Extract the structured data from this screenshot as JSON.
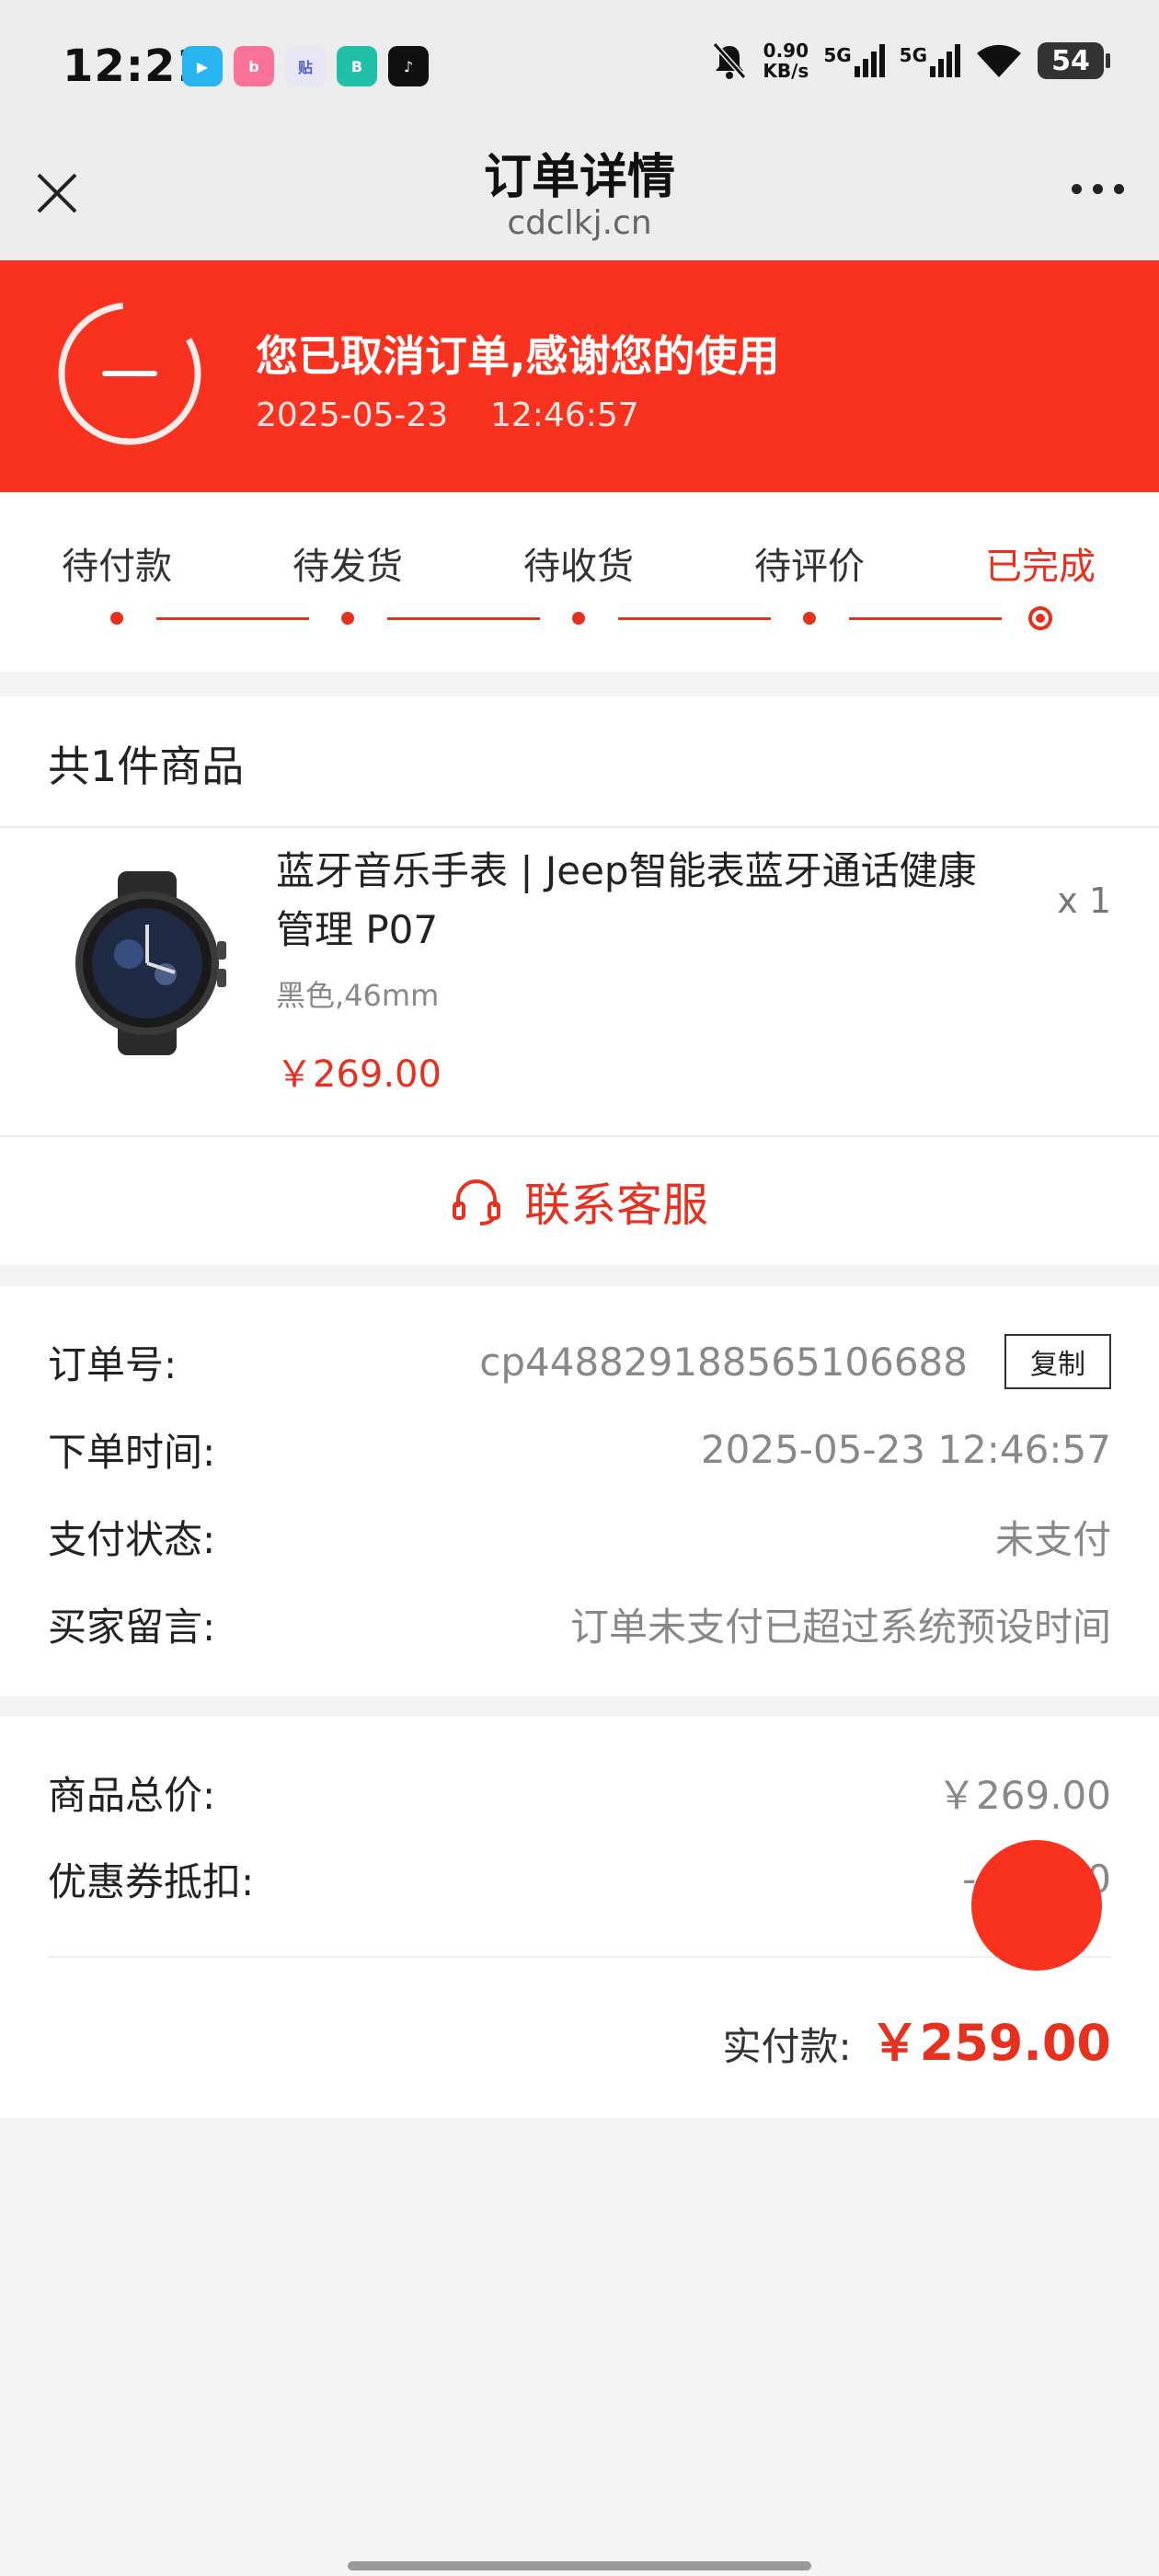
{
  "status_bar": {
    "time": "12:21",
    "net_speed_value": "0.90",
    "net_speed_unit": "KB/s",
    "signal_1": "5G",
    "signal_2": "5G",
    "battery": "54",
    "apps": [
      "iqiyi-app-icon",
      "bilibili-app-icon",
      "tieba-app-icon",
      "boss-app-icon",
      "tiktok-app-icon"
    ]
  },
  "nav": {
    "title": "订单详情",
    "subtitle": "cdclkj.cn"
  },
  "banner": {
    "title": "您已取消订单,感谢您的使用",
    "date": "2025-05-23",
    "time": "12:46:57"
  },
  "progress": {
    "steps": [
      "待付款",
      "待发货",
      "待收货",
      "待评价",
      "已完成"
    ],
    "current_index": 4
  },
  "goods": {
    "count_label": "共1件商品",
    "name": "蓝牙音乐手表 | Jeep智能表蓝牙通话健康管理 P07",
    "quantity": "x 1",
    "spec": "黑色,46mm",
    "price": "￥269.00",
    "service_label": "联系客服"
  },
  "order_info": {
    "order_no_label": "订单号:",
    "order_no": "cp448829188565106688",
    "copy_label": "复制",
    "order_time_label": "下单时间:",
    "order_time": "2025-05-23 12:46:57",
    "pay_status_label": "支付状态:",
    "pay_status": "未支付",
    "buyer_msg_label": "买家留言:",
    "buyer_msg": "订单未支付已超过系统预设时间"
  },
  "price": {
    "goods_total_label": "商品总价:",
    "goods_total": "￥269.00",
    "coupon_label": "优惠券抵扣:",
    "coupon": "-",
    "coupon_tail": "0",
    "paid_label": "实付款:",
    "paid": "￥259.00"
  },
  "colors": {
    "accent": "#f8321f",
    "price_red": "#e8301f"
  }
}
